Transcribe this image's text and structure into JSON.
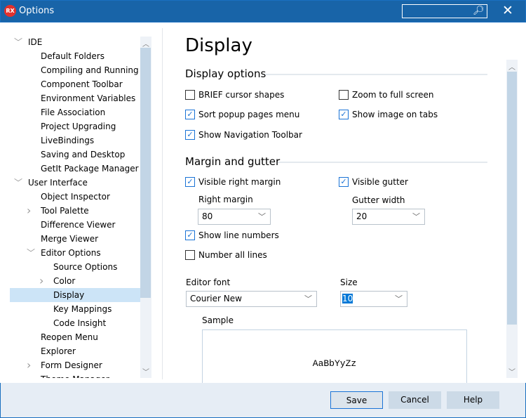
{
  "window": {
    "title": "Options",
    "logo": "RX",
    "search_placeholder": "",
    "search_icon": "search-icon",
    "close_icon": "close-icon"
  },
  "tree": [
    {
      "label": "IDE",
      "level": 0,
      "chevron": "expanded"
    },
    {
      "label": "Default Folders",
      "level": 1
    },
    {
      "label": "Compiling and Running",
      "level": 1
    },
    {
      "label": "Component Toolbar",
      "level": 1
    },
    {
      "label": "Environment Variables",
      "level": 1
    },
    {
      "label": "File Association",
      "level": 1
    },
    {
      "label": "Project Upgrading",
      "level": 1
    },
    {
      "label": "LiveBindings",
      "level": 1
    },
    {
      "label": "Saving and Desktop",
      "level": 1
    },
    {
      "label": "GetIt Package Manager",
      "level": 1
    },
    {
      "label": "User Interface",
      "level": 0,
      "chevron": "expanded"
    },
    {
      "label": "Object Inspector",
      "level": 1
    },
    {
      "label": "Tool Palette",
      "level": 1,
      "chevron": "collapsed"
    },
    {
      "label": "Difference Viewer",
      "level": 1
    },
    {
      "label": "Merge Viewer",
      "level": 1
    },
    {
      "label": "Editor Options",
      "level": 1,
      "chevron": "expanded"
    },
    {
      "label": "Source Options",
      "level": 2
    },
    {
      "label": "Color",
      "level": 2,
      "chevron": "collapsed"
    },
    {
      "label": "Display",
      "level": 2,
      "selected": true
    },
    {
      "label": "Key Mappings",
      "level": 2
    },
    {
      "label": "Code Insight",
      "level": 2
    },
    {
      "label": "Reopen Menu",
      "level": 1
    },
    {
      "label": "Explorer",
      "level": 1
    },
    {
      "label": "Form Designer",
      "level": 1,
      "chevron": "collapsed"
    },
    {
      "label": "Theme Manager",
      "level": 1
    }
  ],
  "main": {
    "heading": "Display",
    "display_options": {
      "title": "Display options",
      "brief_cursor": {
        "label": "BRIEF cursor shapes",
        "checked": false
      },
      "zoom_full": {
        "label": "Zoom to full screen",
        "checked": false
      },
      "sort_popup": {
        "label": "Sort popup pages menu",
        "checked": true
      },
      "show_image_tabs": {
        "label": "Show image on tabs",
        "checked": true
      },
      "show_nav_toolbar": {
        "label": "Show Navigation Toolbar",
        "checked": true
      }
    },
    "margin_gutter": {
      "title": "Margin and gutter",
      "visible_right_margin": {
        "label": "Visible right margin",
        "checked": true
      },
      "visible_gutter": {
        "label": "Visible gutter",
        "checked": true
      },
      "right_margin_label": "Right margin",
      "right_margin_value": "80",
      "gutter_width_label": "Gutter width",
      "gutter_width_value": "20",
      "show_line_numbers": {
        "label": "Show line numbers",
        "checked": true
      },
      "number_all_lines": {
        "label": "Number all lines",
        "checked": false
      }
    },
    "editor_font_label": "Editor font",
    "editor_font_value": "Courier New",
    "size_label": "Size",
    "size_value": "10",
    "sample_label": "Sample",
    "sample_text": "AaBbYyZz"
  },
  "footer": {
    "save": "Save",
    "cancel": "Cancel",
    "help": "Help"
  },
  "colors": {
    "titlebar": "#1864a8",
    "selection": "#cce4f7",
    "accent": "#1a73d6",
    "footer": "#e6edf5"
  }
}
